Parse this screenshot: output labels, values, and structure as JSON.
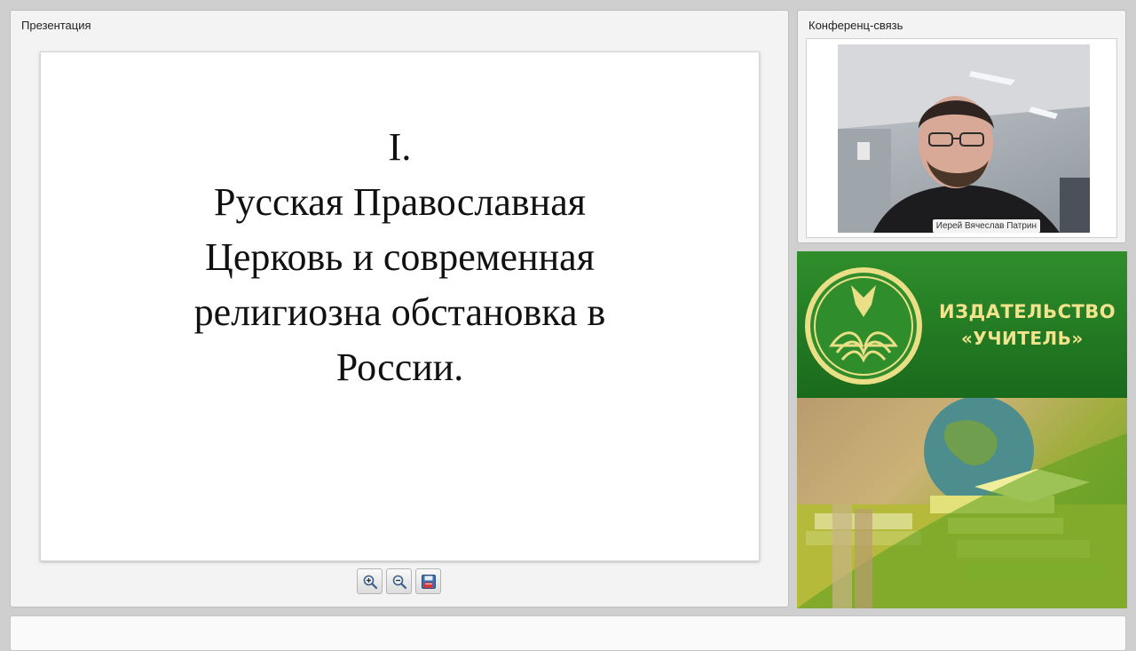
{
  "presentation": {
    "title": "Презентация",
    "slide": {
      "lines": [
        "I.",
        "Русская Православная",
        "Церковь и современная",
        "религиозна обстановка в",
        "России."
      ]
    },
    "toolbar": {
      "zoom_in_icon": "zoom-in-icon",
      "zoom_out_icon": "zoom-out-icon",
      "save_icon": "floppy-disk-icon"
    }
  },
  "conference": {
    "title": "Конференц-связь",
    "speaker_name": "Иерей Вячеслав Патрин"
  },
  "ad": {
    "brand_line1": "ИЗДАТЕЛЬСТВО",
    "brand_line2": "«УЧИТЕЛЬ»",
    "colors": {
      "green": "#1f7a20",
      "gold": "#f2e38c"
    }
  }
}
